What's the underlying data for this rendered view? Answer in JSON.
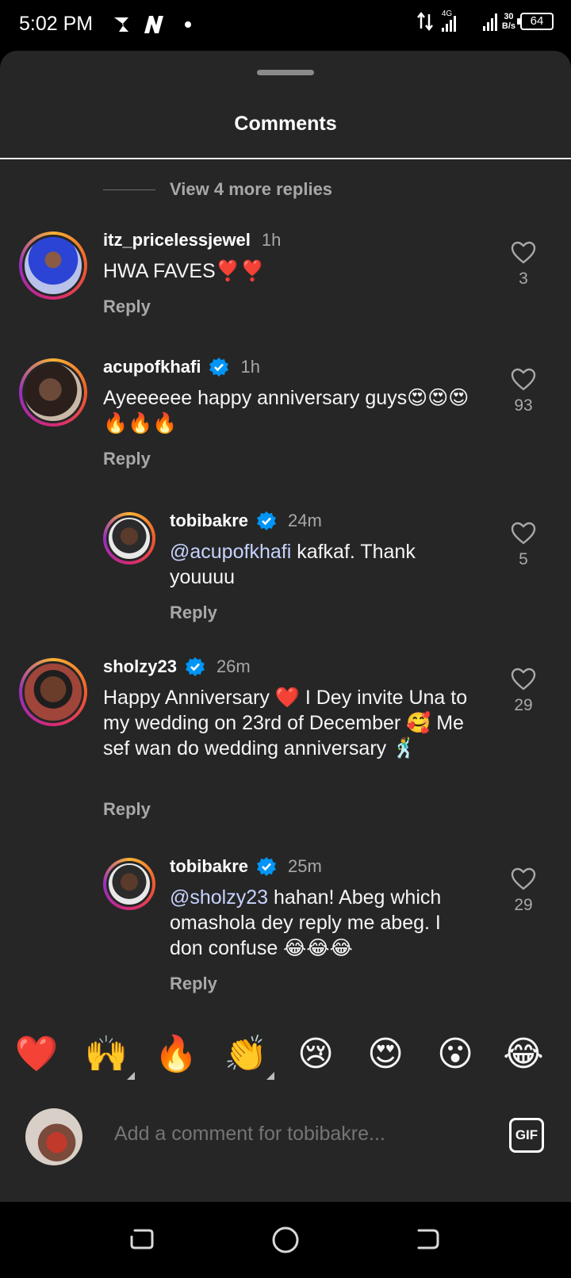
{
  "status_bar": {
    "time": "5:02 PM",
    "network": "4G",
    "speed_top": "30",
    "speed_bottom": "B/s",
    "battery": "64"
  },
  "sheet": {
    "title": "Comments",
    "view_more": "View 4 more replies"
  },
  "comments": [
    {
      "user": "itz_pricelessjewel",
      "time": "1h",
      "verified": false,
      "text": "HWA FAVES❣️❣️",
      "likes": "3",
      "reply": "Reply"
    },
    {
      "user": "acupofkhafi",
      "time": "1h",
      "verified": true,
      "text": "Ayeeeeee happy anniversary guys😍😍😍🔥🔥🔥",
      "likes": "93",
      "reply": "Reply"
    },
    {
      "user": "tobibakre",
      "time": "24m",
      "verified": true,
      "mention": "@acupofkhafi",
      "text": " kafkaf. Thank youuuu",
      "likes": "5",
      "reply": "Reply"
    },
    {
      "user": "sholzy23",
      "time": "26m",
      "verified": true,
      "text": "Happy Anniversary ❤️ I Dey invite Una to my wedding on 23rd of December 🥰 Me sef wan do wedding anniversary 🕺",
      "likes": "29",
      "reply": "Reply"
    },
    {
      "user": "tobibakre",
      "time": "25m",
      "verified": true,
      "mention": "@sholzy23",
      "text": " hahan! Abeg which omashola dey reply me abeg. I don confuse 😂😂😂",
      "likes": "29",
      "reply": "Reply"
    }
  ],
  "reactions": [
    "❤️",
    "🙌",
    "🔥",
    "👏",
    "😢",
    "😍",
    "😮",
    "😂"
  ],
  "composer": {
    "placeholder": "Add a comment for tobibakre...",
    "gif_label": "GIF"
  },
  "colors": {
    "sheet_bg": "#262626",
    "verified": "#0095f6",
    "muted_text": "#a8a8a8"
  }
}
